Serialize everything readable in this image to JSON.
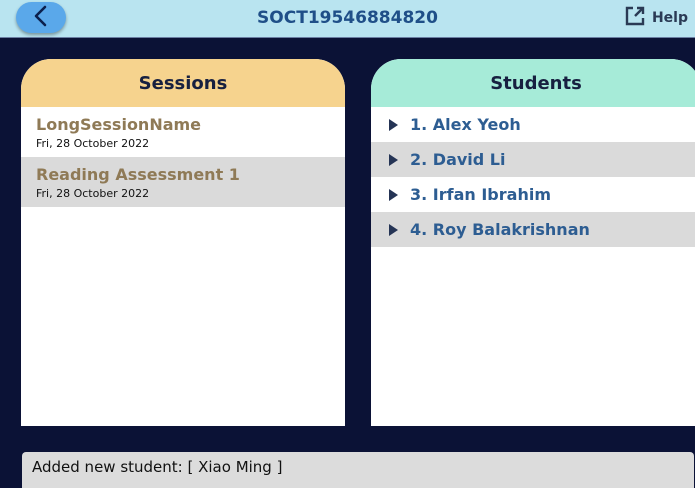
{
  "header": {
    "title": "SOCT19546884820",
    "help_label": "Help",
    "back_icon": "chevron-left-icon",
    "help_icon": "external-link-icon"
  },
  "sessions": {
    "heading": "Sessions",
    "items": [
      {
        "name": "LongSessionName",
        "date": "Fri, 28 October 2022"
      },
      {
        "name": "Reading Assessment 1",
        "date": "Fri, 28 October 2022"
      }
    ]
  },
  "students": {
    "heading": "Students",
    "items": [
      {
        "label": "1. Alex Yeoh"
      },
      {
        "label": "2. David Li"
      },
      {
        "label": "3. Irfan Ibrahim"
      },
      {
        "label": "4. Roy Balakrishnan"
      }
    ]
  },
  "status": {
    "message": "Added new student: [ Xiao Ming ]"
  },
  "colors": {
    "background": "#0b1236",
    "topbar": "#b9e4f0",
    "sessions_header": "#f6d38e",
    "students_header": "#a6ebd8",
    "back_button": "#5aa8ea",
    "title_text": "#1f4f88"
  }
}
